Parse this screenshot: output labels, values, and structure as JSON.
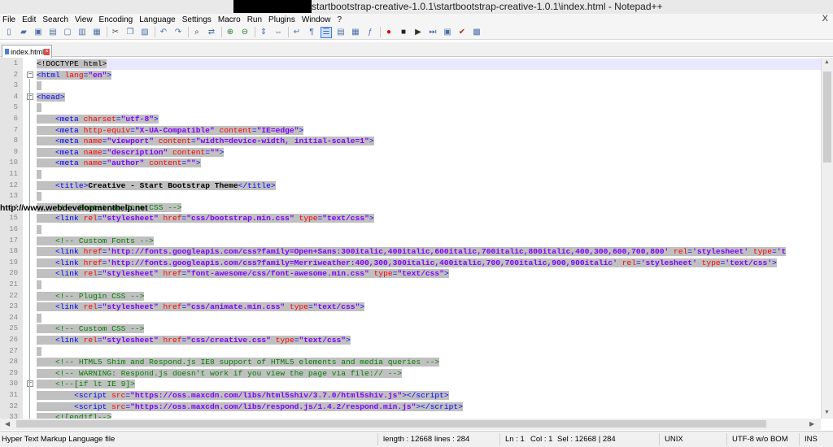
{
  "window": {
    "title": "startbootstrap-creative-1.0.1\\startbootstrap-creative-1.0.1\\index.html - Notepad++",
    "close_label": "X"
  },
  "menu": [
    "File",
    "Edit",
    "Search",
    "View",
    "Encoding",
    "Language",
    "Settings",
    "Macro",
    "Run",
    "Plugins",
    "Window",
    "?"
  ],
  "tab": {
    "label": "index.html",
    "close_label": "×"
  },
  "watermark": "http://www.webdevelopmenthelp.net",
  "lines": [
    {
      "n": "1",
      "html": "<span class=\"sel\">&lt;!DOCTYPE html&gt;</span>"
    },
    {
      "n": "2",
      "html": "<span class=\"sel\"><span class=\"t\">&lt;html </span><span class=\"a\">lang</span><span class=\"t\">=</span><span class=\"v\">\"en\"</span><span class=\"t\">&gt;</span></span>"
    },
    {
      "n": "3",
      "html": "<span class=\"sel\"> </span>"
    },
    {
      "n": "4",
      "html": "<span class=\"sel\"><span class=\"t\">&lt;head&gt;</span></span>"
    },
    {
      "n": "5",
      "html": "<span class=\"sel\"> </span>"
    },
    {
      "n": "6",
      "html": "<span class=\"sel\">    <span class=\"t\">&lt;meta </span><span class=\"a\">charset</span><span class=\"t\">=</span><span class=\"v\">\"utf-8\"</span><span class=\"t\">&gt;</span></span>"
    },
    {
      "n": "7",
      "html": "<span class=\"sel\">    <span class=\"t\">&lt;meta </span><span class=\"a\">http-equiv</span><span class=\"t\">=</span><span class=\"v\">\"X-UA-Compatible\"</span> <span class=\"a\">content</span><span class=\"t\">=</span><span class=\"v\">\"IE=edge\"</span><span class=\"t\">&gt;</span></span>"
    },
    {
      "n": "8",
      "html": "<span class=\"sel\">    <span class=\"t\">&lt;meta </span><span class=\"a\">name</span><span class=\"t\">=</span><span class=\"v\">\"viewport\"</span> <span class=\"a\">content</span><span class=\"t\">=</span><span class=\"v\">\"width=device-width, initial-scale=1\"</span><span class=\"t\">&gt;</span></span>"
    },
    {
      "n": "9",
      "html": "<span class=\"sel\">    <span class=\"t\">&lt;meta </span><span class=\"a\">name</span><span class=\"t\">=</span><span class=\"v\">\"description\"</span> <span class=\"a\">content</span><span class=\"t\">=</span><span class=\"v\">\"\"</span><span class=\"t\">&gt;</span></span>"
    },
    {
      "n": "10",
      "html": "<span class=\"sel\">    <span class=\"t\">&lt;meta </span><span class=\"a\">name</span><span class=\"t\">=</span><span class=\"v\">\"author\"</span> <span class=\"a\">content</span><span class=\"t\">=</span><span class=\"v\">\"\"</span><span class=\"t\">&gt;</span></span>"
    },
    {
      "n": "11",
      "html": "<span class=\"sel\"> </span>"
    },
    {
      "n": "12",
      "html": "<span class=\"sel\">    <span class=\"t\">&lt;title&gt;</span><span class=\"b\">Creative - Start Bootstrap Theme</span><span class=\"t\">&lt;/title&gt;</span></span>"
    },
    {
      "n": "13",
      "html": "<span class=\"sel\"> </span>"
    },
    {
      "n": "14",
      "html": "<span class=\"sel\">    <span class=\"c\">&lt;!-- Bootstrap Core CSS --&gt;</span></span>"
    },
    {
      "n": "15",
      "html": "<span class=\"sel\">    <span class=\"t\">&lt;link </span><span class=\"a\">rel</span><span class=\"t\">=</span><span class=\"v\">\"stylesheet\"</span> <span class=\"a\">href</span><span class=\"t\">=</span><span class=\"v\">\"css/bootstrap.min.css\"</span> <span class=\"a\">type</span><span class=\"t\">=</span><span class=\"v\">\"text/css\"</span><span class=\"t\">&gt;</span></span>"
    },
    {
      "n": "16",
      "html": "<span class=\"sel\"> </span>"
    },
    {
      "n": "17",
      "html": "<span class=\"sel\">    <span class=\"c\">&lt;!-- Custom Fonts --&gt;</span></span>"
    },
    {
      "n": "18",
      "html": "<span class=\"sel\">    <span class=\"t\">&lt;link </span><span class=\"a\">href</span><span class=\"t\">=</span><span class=\"v\">'http://fonts.googleapis.com/css?family=Open+Sans:300italic,400italic,600italic,700italic,800italic,400,300,600,700,800'</span> <span class=\"a\">rel</span><span class=\"t\">=</span><span class=\"v\">'stylesheet'</span> <span class=\"a\">type</span><span class=\"t\">=</span><span class=\"v\">'t</span></span>"
    },
    {
      "n": "19",
      "html": "<span class=\"sel\">    <span class=\"t\">&lt;link </span><span class=\"a\">href</span><span class=\"t\">=</span><span class=\"v\">'http://fonts.googleapis.com/css?family=Merriweather:400,300,300italic,400italic,700,700italic,900,900italic'</span> <span class=\"a\">rel</span><span class=\"t\">=</span><span class=\"v\">'stylesheet'</span> <span class=\"a\">type</span><span class=\"t\">=</span><span class=\"v\">'text/css'</span><span class=\"t\">&gt;</span></span>"
    },
    {
      "n": "20",
      "html": "<span class=\"sel\">    <span class=\"t\">&lt;link </span><span class=\"a\">rel</span><span class=\"t\">=</span><span class=\"v\">\"stylesheet\"</span> <span class=\"a\">href</span><span class=\"t\">=</span><span class=\"v\">\"font-awesome/css/font-awesome.min.css\"</span> <span class=\"a\">type</span><span class=\"t\">=</span><span class=\"v\">\"text/css\"</span><span class=\"t\">&gt;</span></span>"
    },
    {
      "n": "21",
      "html": "<span class=\"sel\"> </span>"
    },
    {
      "n": "22",
      "html": "<span class=\"sel\">    <span class=\"c\">&lt;!-- Plugin CSS --&gt;</span></span>"
    },
    {
      "n": "23",
      "html": "<span class=\"sel\">    <span class=\"t\">&lt;link </span><span class=\"a\">rel</span><span class=\"t\">=</span><span class=\"v\">\"stylesheet\"</span> <span class=\"a\">href</span><span class=\"t\">=</span><span class=\"v\">\"css/animate.min.css\"</span> <span class=\"a\">type</span><span class=\"t\">=</span><span class=\"v\">\"text/css\"</span><span class=\"t\">&gt;</span></span>"
    },
    {
      "n": "24",
      "html": "<span class=\"sel\"> </span>"
    },
    {
      "n": "25",
      "html": "<span class=\"sel\">    <span class=\"c\">&lt;!-- Custom CSS --&gt;</span></span>"
    },
    {
      "n": "26",
      "html": "<span class=\"sel\">    <span class=\"t\">&lt;link </span><span class=\"a\">rel</span><span class=\"t\">=</span><span class=\"v\">\"stylesheet\"</span> <span class=\"a\">href</span><span class=\"t\">=</span><span class=\"v\">\"css/creative.css\"</span> <span class=\"a\">type</span><span class=\"t\">=</span><span class=\"v\">\"text/css\"</span><span class=\"t\">&gt;</span></span>"
    },
    {
      "n": "27",
      "html": "<span class=\"sel\"> </span>"
    },
    {
      "n": "28",
      "html": "<span class=\"sel\">    <span class=\"c\">&lt;!-- HTML5 Shim and Respond.js IE8 support of HTML5 elements and media queries --&gt;</span></span>"
    },
    {
      "n": "29",
      "html": "<span class=\"sel\">    <span class=\"c\">&lt;!-- WARNING: Respond.js doesn't work if you view the page via file:// --&gt;</span></span>"
    },
    {
      "n": "30",
      "html": "<span class=\"sel\">    <span class=\"c\">&lt;!--[if lt IE 9]&gt;</span></span>"
    },
    {
      "n": "31",
      "html": "<span class=\"sel\">        <span class=\"t\">&lt;script </span><span class=\"a\">src</span><span class=\"t\">=</span><span class=\"v\">\"https://oss.maxcdn.com/libs/html5shiv/3.7.0/html5shiv.js\"</span><span class=\"t\">&gt;&lt;/script&gt;</span></span>"
    },
    {
      "n": "32",
      "html": "<span class=\"sel\">        <span class=\"t\">&lt;script </span><span class=\"a\">src</span><span class=\"t\">=</span><span class=\"v\">\"https://oss.maxcdn.com/libs/respond.js/1.4.2/respond.min.js\"</span><span class=\"t\">&gt;&lt;/script&gt;</span></span>"
    },
    {
      "n": "33",
      "html": "<span class=\"sel\">    <span class=\"c\">&lt;![endif]--&gt;</span></span>"
    }
  ],
  "status": {
    "file_type": "Hyper Text Markup Language file",
    "length": "length : 12668",
    "lines": "lines : 284",
    "ln": "Ln : 1",
    "col": "Col : 1",
    "sel": "Sel : 12668 | 284",
    "eol": "UNIX",
    "encoding": "UTF-8 w/o BOM",
    "mode": "INS"
  },
  "toolbar_icons": [
    "new-file-icon",
    "open-file-icon",
    "save-icon",
    "save-all-icon",
    "close-icon",
    "close-all-icon",
    "print-icon",
    "cut-icon",
    "copy-icon",
    "paste-icon",
    "undo-icon",
    "redo-icon",
    "find-icon",
    "replace-icon",
    "zoom-in-icon",
    "zoom-out-icon",
    "sync-v-icon",
    "sync-h-icon",
    "word-wrap-icon",
    "show-all-chars-icon",
    "indent-guide-icon",
    "user-lang-icon",
    "doc-map-icon",
    "function-list-icon",
    "record-macro-icon",
    "stop-macro-icon",
    "play-macro-icon",
    "play-multiple-icon",
    "save-macro-icon",
    "spellcheck-icon",
    "spellcheck-auto-icon"
  ]
}
